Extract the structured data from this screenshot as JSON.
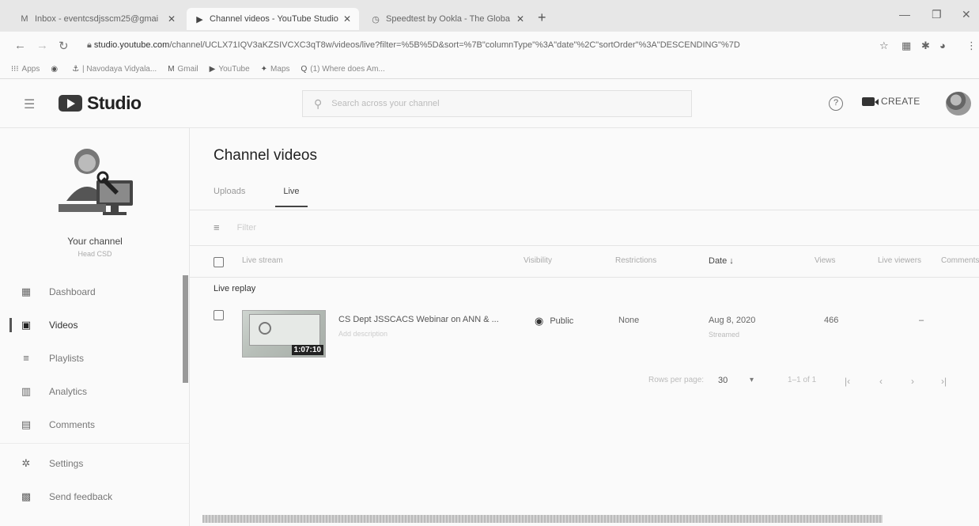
{
  "browser": {
    "tabs": [
      {
        "icon": "M",
        "title": "Inbox - eventcsdjsscm25@gmai",
        "active": false
      },
      {
        "icon": "▶",
        "title": "Channel videos - YouTube Studio",
        "active": true
      },
      {
        "icon": "◷",
        "title": "Speedtest by Ookla - The Globa",
        "active": false
      }
    ],
    "new_tab": "+",
    "url_domain": "studio.youtube.com",
    "url_path": "/channel/UCLX71IQV3aKZSIVCXC3qT8w/videos/live?filter=%5B%5D&sort=%7B\"columnType\"%3A\"date\"%2C\"sortOrder\"%3A\"DESCENDING\"%7D",
    "bookmarks": [
      {
        "icon": "⁝⁝⁝",
        "label": "Apps"
      },
      {
        "icon": "◉",
        "label": ""
      },
      {
        "icon": "⚓",
        "label": "| Navodaya Vidyala..."
      },
      {
        "icon": "M",
        "label": "Gmail"
      },
      {
        "icon": "▶",
        "label": "YouTube"
      },
      {
        "icon": "✦",
        "label": "Maps"
      },
      {
        "icon": "Q",
        "label": "(1) Where does Am..."
      }
    ]
  },
  "header": {
    "logo_text": "Studio",
    "search_placeholder": "Search across your channel",
    "help_glyph": "?",
    "create_label": "CREATE"
  },
  "sidebar": {
    "channel_title": "Your channel",
    "channel_sub": "Head CSD",
    "items": [
      {
        "icon": "dashboard-icon",
        "glyph": "▦",
        "label": "Dashboard",
        "active": false
      },
      {
        "icon": "videos-icon",
        "glyph": "▣",
        "label": "Videos",
        "active": true
      },
      {
        "icon": "playlists-icon",
        "glyph": "≡",
        "label": "Playlists",
        "active": false
      },
      {
        "icon": "analytics-icon",
        "glyph": "▥",
        "label": "Analytics",
        "active": false
      },
      {
        "icon": "comments-icon",
        "glyph": "▤",
        "label": "Comments",
        "active": false
      },
      {
        "icon": "settings-icon",
        "glyph": "✲",
        "label": "Settings",
        "active": false
      },
      {
        "icon": "feedback-icon",
        "glyph": "▩",
        "label": "Send feedback",
        "active": false
      }
    ]
  },
  "main": {
    "title": "Channel videos",
    "tabs": [
      {
        "label": "Uploads"
      },
      {
        "label": "Live"
      }
    ],
    "filter_placeholder": "Filter",
    "columns": {
      "stream": "Live stream",
      "visibility": "Visibility",
      "restrictions": "Restrictions",
      "date": "Date ↓",
      "views": "Views",
      "live_viewers": "Live viewers",
      "comments": "Comments"
    },
    "section_label": "Live replay",
    "row": {
      "duration": "1:07:10",
      "title": "CS Dept JSSCACS Webinar on ANN & ...",
      "description": "Add description",
      "visibility": "Public",
      "restrictions": "None",
      "date": "Aug 8, 2020",
      "date_sub": "Streamed",
      "views": "466",
      "live_viewers": "–"
    },
    "pagination": {
      "rows_label": "Rows per page:",
      "rows_value": "30",
      "range": "1–1 of 1"
    }
  },
  "colors": {
    "background": "#fafafa",
    "active_indicator": "#555555"
  }
}
